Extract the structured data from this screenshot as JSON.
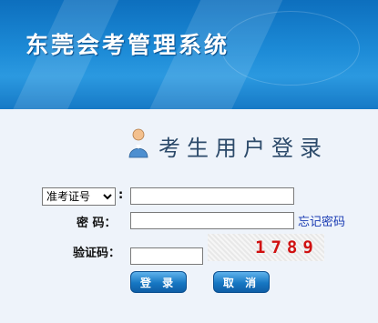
{
  "header": {
    "title": "东莞会考管理系统"
  },
  "login": {
    "title": "考生用户登录",
    "id_type": {
      "selected": "准考证号",
      "options": [
        "准考证号"
      ]
    },
    "colon": ":",
    "password_label": "密  码：",
    "forgot_link": "忘记密码",
    "captcha_label": "验证码：",
    "captcha_code": "1789",
    "submit_label": "登 录",
    "cancel_label": "取 消"
  }
}
